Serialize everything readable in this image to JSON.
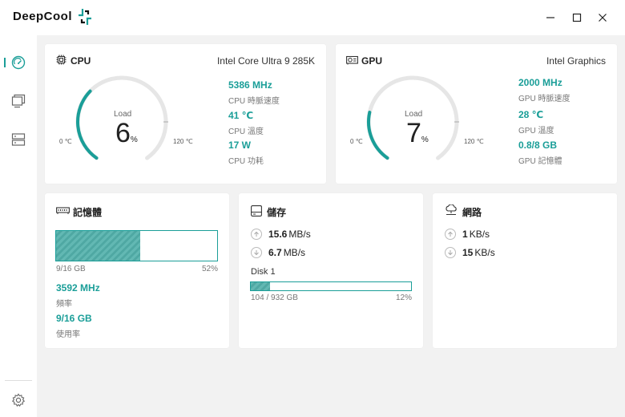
{
  "app": {
    "brand": "DeepCool",
    "window_controls": {
      "minimize": "minimize-icon",
      "maximize": "maximize-icon",
      "close": "close-icon"
    }
  },
  "sidebar": {
    "items": [
      {
        "icon": "gauge-icon",
        "active": true
      },
      {
        "icon": "monitor-icon",
        "active": false
      },
      {
        "icon": "server-icon",
        "active": false
      }
    ],
    "bottom_icon": "gear-icon"
  },
  "cpu": {
    "title": "CPU",
    "model": "Intel Core Ultra 9 285K",
    "gauge": {
      "label": "Load",
      "value": "6",
      "unit": "%",
      "min": "0 ℃",
      "max": "120 ℃",
      "fraction": 0.06,
      "temp_fraction": 0.342
    },
    "stats": [
      {
        "value": "5386 MHz",
        "label": "CPU 時脈速度"
      },
      {
        "value": "41 ℃",
        "label": "CPU 溫度"
      },
      {
        "value": "17 W",
        "label": "CPU 功耗"
      }
    ]
  },
  "gpu": {
    "title": "GPU",
    "model": "Intel Graphics",
    "gauge": {
      "label": "Load",
      "value": "7",
      "unit": "%",
      "min": "0 ℃",
      "max": "120 ℃",
      "fraction": 0.07,
      "temp_fraction": 0.233
    },
    "stats": [
      {
        "value": "2000 MHz",
        "label": "GPU 時脈速度"
      },
      {
        "value": "28 ℃",
        "label": "GPU 溫度"
      },
      {
        "value": "0.8/8 GB",
        "label": "GPU 記憶體"
      }
    ]
  },
  "memory": {
    "title": "記憶體",
    "usage_text": "9/16 GB",
    "percent_text": "52%",
    "fill_fraction": 0.52,
    "stats": [
      {
        "value": "3592 MHz",
        "label": "頻率"
      },
      {
        "value": "9/16 GB",
        "label": "使用率"
      }
    ]
  },
  "storage": {
    "title": "儲存",
    "read": {
      "value": "15.6",
      "unit": "MB/s"
    },
    "write": {
      "value": "6.7",
      "unit": "MB/s"
    },
    "disk": {
      "name": "Disk 1",
      "usage_text": "104 / 932 GB",
      "percent_text": "12%",
      "fill_fraction": 0.12
    }
  },
  "network": {
    "title": "網路",
    "upload": {
      "value": "1",
      "unit": "KB/s"
    },
    "download": {
      "value": "15",
      "unit": "KB/s"
    }
  },
  "colors": {
    "accent": "#1a9e98",
    "track": "#e6e6e6",
    "background": "#f2f2f2"
  }
}
